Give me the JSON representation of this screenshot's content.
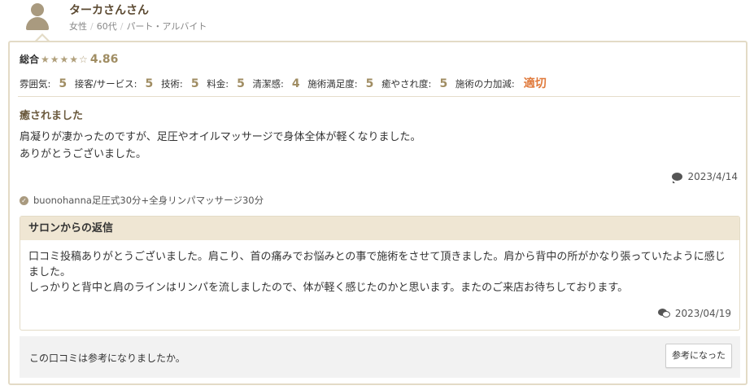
{
  "reviewer": {
    "name": "ターカさんさん",
    "gender": "女性",
    "age": "60代",
    "occupation": "パート・アルバイト"
  },
  "rating": {
    "overall_label": "総合",
    "stars": "★★★★☆",
    "star_level": 4.86,
    "overall_score": "4.86",
    "items": [
      {
        "label": "雰囲気:",
        "value": "5"
      },
      {
        "label": "接客/サービス:",
        "value": "5"
      },
      {
        "label": "技術:",
        "value": "5"
      },
      {
        "label": "料金:",
        "value": "5"
      },
      {
        "label": "清潔感:",
        "value": "4"
      },
      {
        "label": "施術満足度:",
        "value": "5"
      },
      {
        "label": "癒やされ度:",
        "value": "5"
      },
      {
        "label": "施術の力加減:",
        "value": "適切"
      }
    ]
  },
  "review": {
    "title": "癒されました",
    "body_line1": "肩凝りが凄かったのですが、足圧やオイルマッサージで身体全体が軽くなりました。",
    "body_line2": "ありがとうございました。",
    "date": "2023/4/14",
    "menu": "buonohanna足圧式30分+全身リンパマッサージ30分"
  },
  "reply": {
    "heading": "サロンからの返信",
    "body_line1": "口コミ投稿ありがとうございました。肩こり、首の痛みでお悩みとの事で施術をさせて頂きました。肩から背中の所がかなり張っていたように感じました。",
    "body_line2": "しっかりと背中と肩のラインはリンパを流しましたので、体が軽く感じたのかと思います。またのご来店お待ちしております。",
    "date": "2023/04/19"
  },
  "helpful": {
    "question": "この口コミは参考になりましたか。",
    "button_label": "参考になった"
  },
  "colors": {
    "accent_gold": "#a08d63",
    "accent_orange": "#e07a3c",
    "border": "#e3dbc6"
  },
  "icons": [
    "user-avatar-icon",
    "star-icon",
    "comment-icon",
    "check-circle-icon",
    "comments-icon"
  ]
}
